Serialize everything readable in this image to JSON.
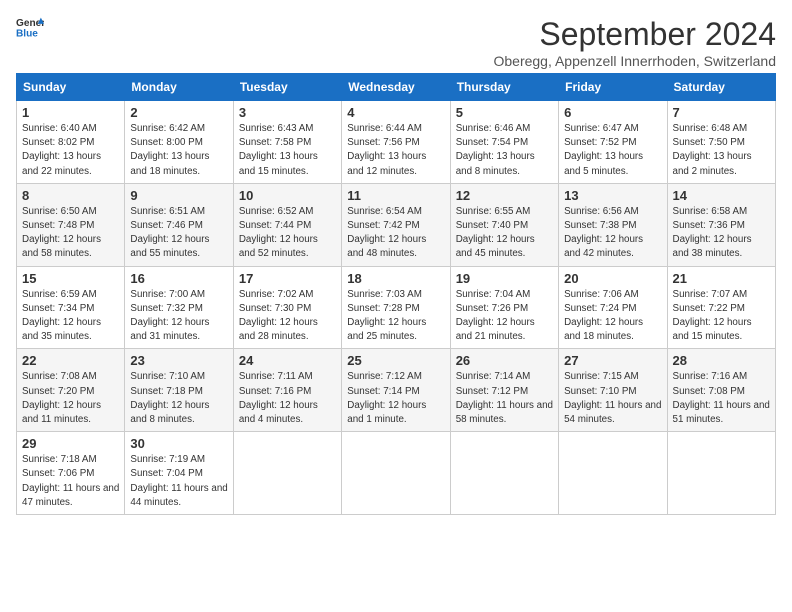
{
  "header": {
    "logo_general": "General",
    "logo_blue": "Blue",
    "title": "September 2024",
    "subtitle": "Oberegg, Appenzell Innerrhoden, Switzerland"
  },
  "weekdays": [
    "Sunday",
    "Monday",
    "Tuesday",
    "Wednesday",
    "Thursday",
    "Friday",
    "Saturday"
  ],
  "weeks": [
    [
      {
        "day": "1",
        "sunrise": "6:40 AM",
        "sunset": "8:02 PM",
        "daylight": "13 hours and 22 minutes."
      },
      {
        "day": "2",
        "sunrise": "6:42 AM",
        "sunset": "8:00 PM",
        "daylight": "13 hours and 18 minutes."
      },
      {
        "day": "3",
        "sunrise": "6:43 AM",
        "sunset": "7:58 PM",
        "daylight": "13 hours and 15 minutes."
      },
      {
        "day": "4",
        "sunrise": "6:44 AM",
        "sunset": "7:56 PM",
        "daylight": "13 hours and 12 minutes."
      },
      {
        "day": "5",
        "sunrise": "6:46 AM",
        "sunset": "7:54 PM",
        "daylight": "13 hours and 8 minutes."
      },
      {
        "day": "6",
        "sunrise": "6:47 AM",
        "sunset": "7:52 PM",
        "daylight": "13 hours and 5 minutes."
      },
      {
        "day": "7",
        "sunrise": "6:48 AM",
        "sunset": "7:50 PM",
        "daylight": "13 hours and 2 minutes."
      }
    ],
    [
      {
        "day": "8",
        "sunrise": "6:50 AM",
        "sunset": "7:48 PM",
        "daylight": "12 hours and 58 minutes."
      },
      {
        "day": "9",
        "sunrise": "6:51 AM",
        "sunset": "7:46 PM",
        "daylight": "12 hours and 55 minutes."
      },
      {
        "day": "10",
        "sunrise": "6:52 AM",
        "sunset": "7:44 PM",
        "daylight": "12 hours and 52 minutes."
      },
      {
        "day": "11",
        "sunrise": "6:54 AM",
        "sunset": "7:42 PM",
        "daylight": "12 hours and 48 minutes."
      },
      {
        "day": "12",
        "sunrise": "6:55 AM",
        "sunset": "7:40 PM",
        "daylight": "12 hours and 45 minutes."
      },
      {
        "day": "13",
        "sunrise": "6:56 AM",
        "sunset": "7:38 PM",
        "daylight": "12 hours and 42 minutes."
      },
      {
        "day": "14",
        "sunrise": "6:58 AM",
        "sunset": "7:36 PM",
        "daylight": "12 hours and 38 minutes."
      }
    ],
    [
      {
        "day": "15",
        "sunrise": "6:59 AM",
        "sunset": "7:34 PM",
        "daylight": "12 hours and 35 minutes."
      },
      {
        "day": "16",
        "sunrise": "7:00 AM",
        "sunset": "7:32 PM",
        "daylight": "12 hours and 31 minutes."
      },
      {
        "day": "17",
        "sunrise": "7:02 AM",
        "sunset": "7:30 PM",
        "daylight": "12 hours and 28 minutes."
      },
      {
        "day": "18",
        "sunrise": "7:03 AM",
        "sunset": "7:28 PM",
        "daylight": "12 hours and 25 minutes."
      },
      {
        "day": "19",
        "sunrise": "7:04 AM",
        "sunset": "7:26 PM",
        "daylight": "12 hours and 21 minutes."
      },
      {
        "day": "20",
        "sunrise": "7:06 AM",
        "sunset": "7:24 PM",
        "daylight": "12 hours and 18 minutes."
      },
      {
        "day": "21",
        "sunrise": "7:07 AM",
        "sunset": "7:22 PM",
        "daylight": "12 hours and 15 minutes."
      }
    ],
    [
      {
        "day": "22",
        "sunrise": "7:08 AM",
        "sunset": "7:20 PM",
        "daylight": "12 hours and 11 minutes."
      },
      {
        "day": "23",
        "sunrise": "7:10 AM",
        "sunset": "7:18 PM",
        "daylight": "12 hours and 8 minutes."
      },
      {
        "day": "24",
        "sunrise": "7:11 AM",
        "sunset": "7:16 PM",
        "daylight": "12 hours and 4 minutes."
      },
      {
        "day": "25",
        "sunrise": "7:12 AM",
        "sunset": "7:14 PM",
        "daylight": "12 hours and 1 minute."
      },
      {
        "day": "26",
        "sunrise": "7:14 AM",
        "sunset": "7:12 PM",
        "daylight": "11 hours and 58 minutes."
      },
      {
        "day": "27",
        "sunrise": "7:15 AM",
        "sunset": "7:10 PM",
        "daylight": "11 hours and 54 minutes."
      },
      {
        "day": "28",
        "sunrise": "7:16 AM",
        "sunset": "7:08 PM",
        "daylight": "11 hours and 51 minutes."
      }
    ],
    [
      {
        "day": "29",
        "sunrise": "7:18 AM",
        "sunset": "7:06 PM",
        "daylight": "11 hours and 47 minutes."
      },
      {
        "day": "30",
        "sunrise": "7:19 AM",
        "sunset": "7:04 PM",
        "daylight": "11 hours and 44 minutes."
      },
      null,
      null,
      null,
      null,
      null
    ]
  ],
  "labels": {
    "sunrise": "Sunrise:",
    "sunset": "Sunset:",
    "daylight": "Daylight:"
  }
}
